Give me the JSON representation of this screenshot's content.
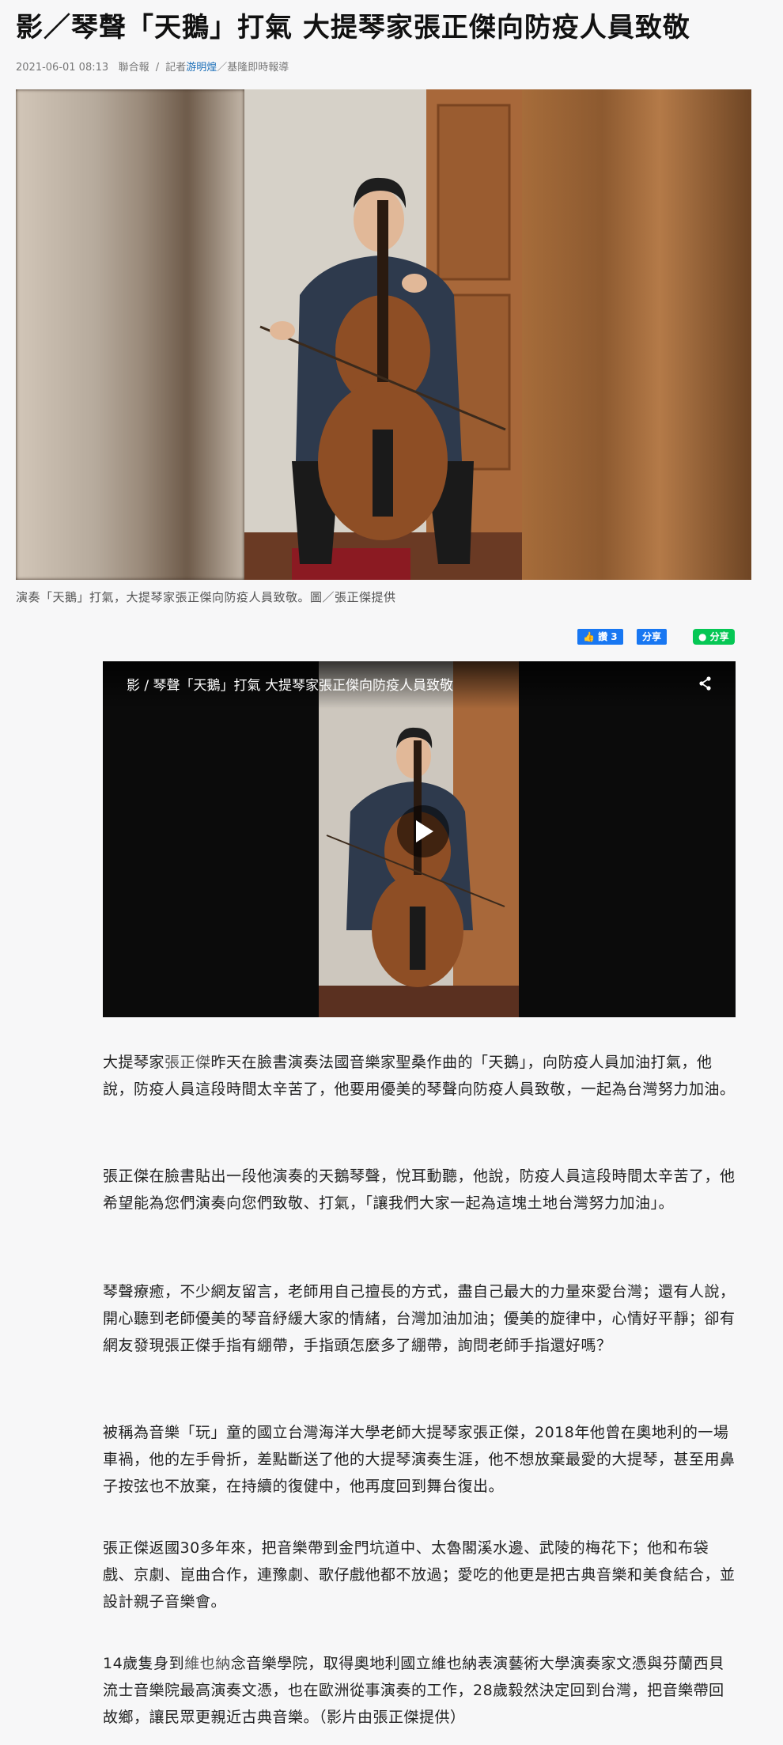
{
  "article": {
    "headline": "影／琴聲「天鵝」打氣 大提琴家張正傑向防疫人員致敬",
    "date": "2021-06-01 08:13",
    "source": "聯合報",
    "reporter_prefix": "記者",
    "reporter": "游明煌",
    "bureau": "／基隆即時報導",
    "meta_sep": "/",
    "caption": "演奏「天鵝」打氣，大提琴家張正傑向防疫人員致敬。圖／張正傑提供"
  },
  "social": {
    "fb_like": "讚 3",
    "fb_share": "分享",
    "line_share": "分享"
  },
  "video": {
    "title": "影 / 琴聲「天鵝」打氣 大提琴家張正傑向防疫人員致敬",
    "share_icon": "share-icon",
    "play_icon": "play-icon"
  },
  "body": {
    "p1_link": "張正傑",
    "p1_prefix": "大提琴家",
    "p1_rest": "昨天在臉書演奏法國音樂家聖桑作曲的「天鵝」，向防疫人員加油打氣，他說，防疫人員這段時間太辛苦了，他要用優美的琴聲向防疫人員致敬，一起為台灣努力加油。",
    "p2": "張正傑在臉書貼出一段他演奏的天鵝琴聲，悅耳動聽，他說，防疫人員這段時間太辛苦了，他希望能為您們演奏向您們致敬、打氣，「讓我們大家一起為這塊土地台灣努力加油」。",
    "p3": "琴聲療癒，不少網友留言，老師用自己擅長的方式，盡自己最大的力量來愛台灣；還有人說，開心聽到老師優美的琴音紓緩大家的情緒，台灣加油加油；優美的旋律中，心情好平靜；卻有網友發現張正傑手指有綳帶，手指頭怎麼多了綳帶，詢問老師手指還好嗎？",
    "p4": "被稱為音樂「玩」童的國立台灣海洋大學老師大提琴家張正傑，2018年他曾在奧地利的一場車禍，他的左手骨折，差點斷送了他的大提琴演奏生涯，他不想放棄最愛的大提琴，甚至用鼻子按弦也不放棄，在持續的復健中，他再度回到舞台復出。",
    "p5": "張正傑返國30多年來，把音樂帶到金門坑道中、太魯閣溪水邊、武陵的梅花下；他和布袋戲、京劇、崑曲合作，連豫劇、歌仔戲他都不放過；愛吃的他更是把古典音樂和美食結合，並設計親子音樂會。",
    "p6_prefix": "14歲隻身到",
    "p6_link": "維也納",
    "p6_rest": "念音樂學院，取得奧地利國立維也納表演藝術大學演奏家文憑與芬蘭西貝流士音樂院最高演奏文憑，也在歐洲從事演奏的工作，28歲毅然決定回到台灣，把音樂帶回故鄉，讓民眾更親近古典音樂。（影片由張正傑提供）"
  }
}
